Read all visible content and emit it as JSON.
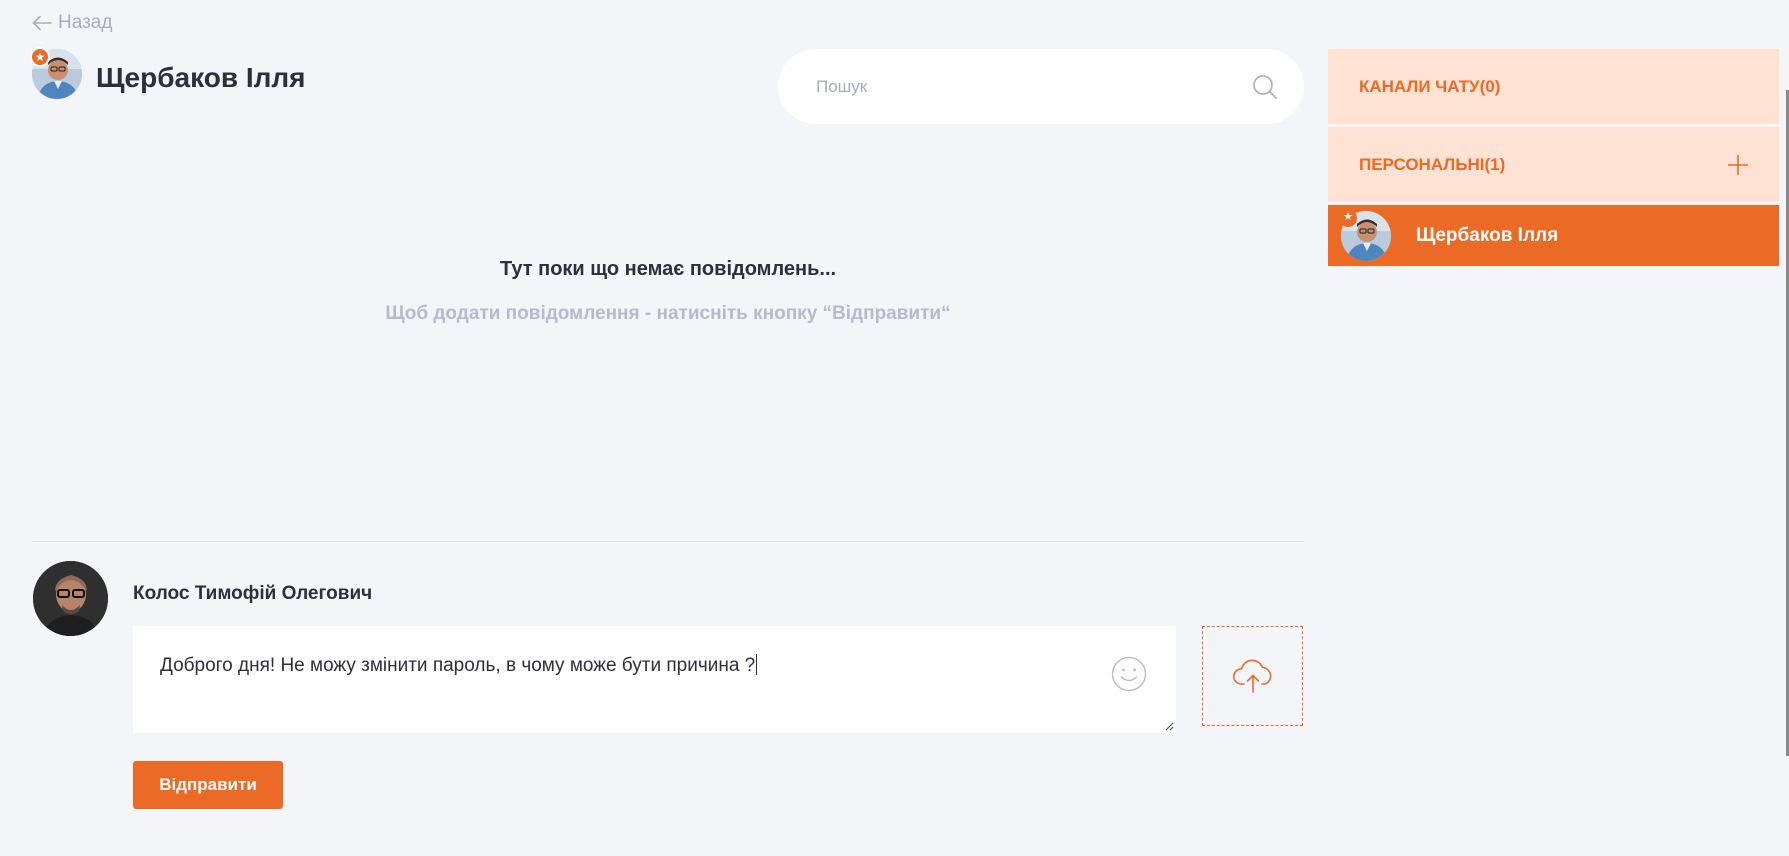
{
  "back": {
    "label": "Назад",
    "icon": "arrow-left-icon"
  },
  "header": {
    "title": "Щербаков Ілля"
  },
  "search": {
    "placeholder": "Пошук",
    "value": "",
    "icon": "search-icon"
  },
  "empty_state": {
    "title": "Тут поки що немає повідомлень...",
    "hint": "Щоб додати повідомлення - натисніть кнопку “Відправити“"
  },
  "composer": {
    "author_name": "Колос Тимофій Олегович",
    "message": "Доброго дня! Не можу змінити пароль, в чому може бути причина ?",
    "emoji_icon": "smiley-icon",
    "upload_icon": "cloud-upload-icon",
    "send_label": "Відправити"
  },
  "sidebar": {
    "channels_label": "КАНАЛИ ЧАТУ(0)",
    "personal_label": "ПЕРСОНАЛЬНІ(1)",
    "add_icon": "plus-icon",
    "contacts": [
      {
        "name": "Щербаков Ілля",
        "starred": true
      }
    ]
  },
  "colors": {
    "accent": "#eb6a25",
    "accent_light": "#fee3d4",
    "background": "#f4f5f9",
    "muted_text": "#b8b9cc"
  }
}
